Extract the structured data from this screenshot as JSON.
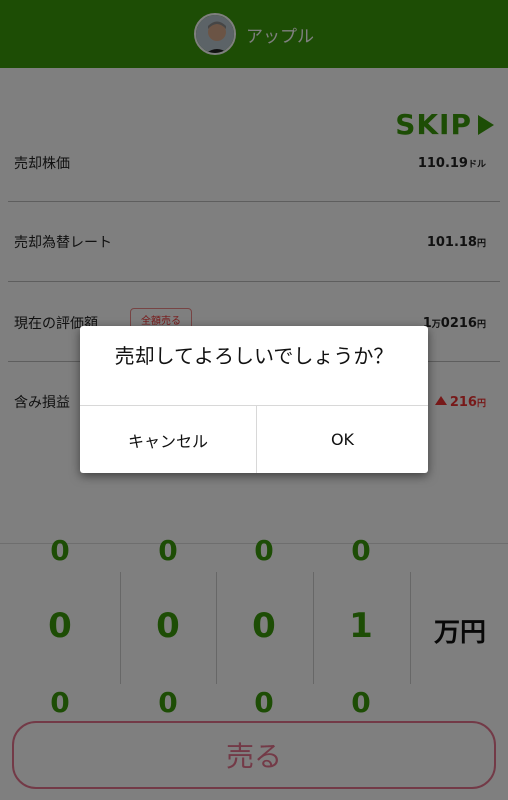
{
  "header": {
    "title": "アップル",
    "avatar_icon": "person-avatar-icon",
    "bg_color": "#3a9a0a"
  },
  "skip": {
    "label": "SKIP",
    "icon": "play-triangle-icon"
  },
  "rows": [
    {
      "label": "売却株価",
      "value": "110.19",
      "unit": "ドル"
    },
    {
      "label": "売却為替レート",
      "value": "101.18",
      "unit": "円"
    },
    {
      "label": "現在の評価額",
      "badge": "全額売る",
      "value_pre": "1",
      "value_man": "万",
      "value": "0216",
      "unit": "円"
    },
    {
      "label": "含み損益",
      "value": "216",
      "unit": "円",
      "icon": "up-arrow-icon"
    }
  ],
  "picker": {
    "columns": [
      {
        "above": "0",
        "value": "0",
        "below": "0"
      },
      {
        "above": "0",
        "value": "0",
        "below": "0"
      },
      {
        "above": "0",
        "value": "0",
        "below": "0"
      },
      {
        "above": "0",
        "value": "1",
        "below": "0"
      }
    ],
    "unit": "万円",
    "accent": "#3a9a0a"
  },
  "sell_button": {
    "label": "売る",
    "color": "#e7758f"
  },
  "dialog": {
    "message": "売却してよろしいでしょうか？",
    "cancel": "キャンセル",
    "ok": "OK"
  }
}
